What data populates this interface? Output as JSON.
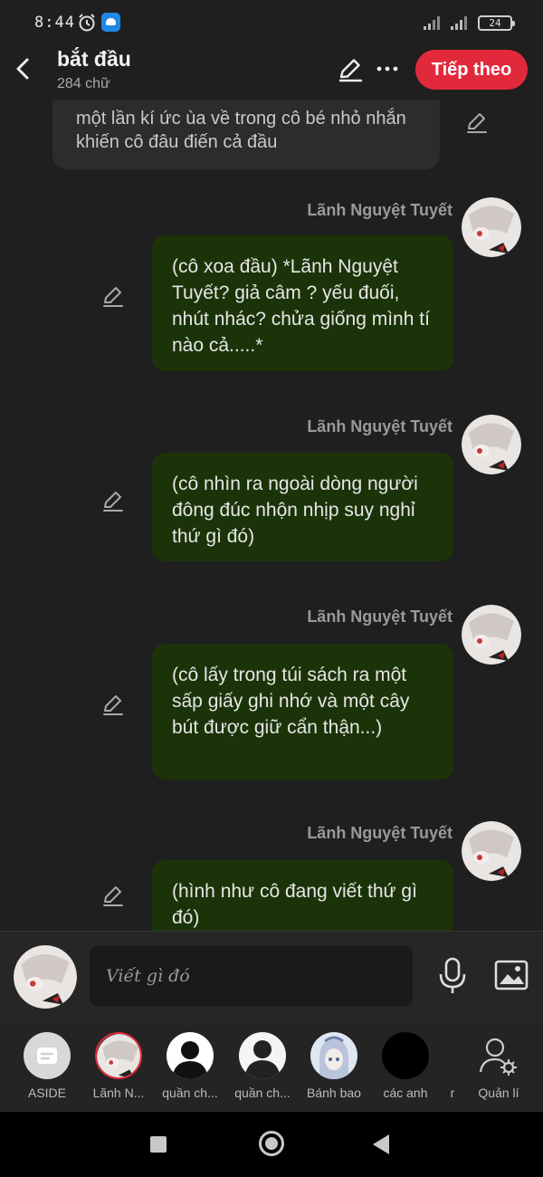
{
  "status_bar": {
    "time": "8:44",
    "battery": "24",
    "icons": [
      "alarm-icon",
      "cloud-app-icon",
      "signal-icon",
      "signal-icon",
      "battery-icon"
    ]
  },
  "header": {
    "title": "bắt đầu",
    "word_count": "284 chữ",
    "next_label": "Tiếp theo",
    "accent": "#e2293b"
  },
  "narration": {
    "text": "một lần kí ức ùa về trong cô bé nhỏ nhắn khiến cô đâu điến cả đầu"
  },
  "messages": [
    {
      "sender": "Lãnh Nguyệt Tuyết",
      "text": "(cô xoa đầu) *Lãnh Nguyệt Tuyết? giả câm ? yếu đuối, nhút nhác? chửa giống mình tí nào cả.....*"
    },
    {
      "sender": "Lãnh Nguyệt Tuyết",
      "text": "(cô nhìn ra ngoài dòng người đông đúc nhộn nhịp suy nghỉ thứ gì đó)"
    },
    {
      "sender": "Lãnh Nguyệt Tuyết",
      "text": "(cô lấy trong túi sách ra một sấp giấy ghi nhớ và một cây bút được giữ cẩn thận...)"
    },
    {
      "sender": "Lãnh Nguyệt Tuyết",
      "text": "(hình như cô đang viết thứ gì đó)"
    }
  ],
  "bubble_color": "#1b3308",
  "input": {
    "placeholder": "Viết gì đó"
  },
  "characters": [
    {
      "label": "ASIDE",
      "icon": "aside-icon"
    },
    {
      "label": "Lãnh N...",
      "icon": "avatar"
    },
    {
      "label": "quần ch...",
      "icon": "silhouette-icon"
    },
    {
      "label": "quần ch...",
      "icon": "silhouette-icon"
    },
    {
      "label": "Bánh bao",
      "icon": "avatar"
    },
    {
      "label": "các anh",
      "icon": "avatar"
    },
    {
      "label": "r",
      "icon": ""
    },
    {
      "label": "Quản lí",
      "icon": "manage-characters-icon"
    }
  ]
}
